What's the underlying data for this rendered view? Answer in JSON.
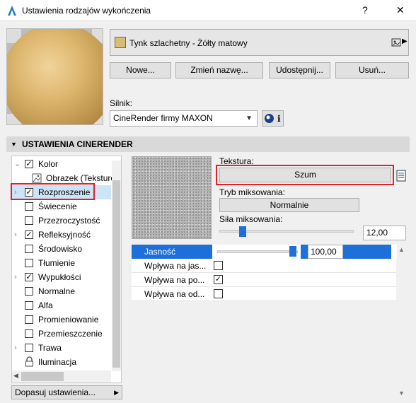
{
  "window": {
    "title": "Ustawienia rodzajów wykończenia",
    "help": "?",
    "close": "✕"
  },
  "material": {
    "name": "Tynk szlachetny - Żółty matowy",
    "swatch_color": "#d8bd72"
  },
  "buttons": {
    "new": "Nowe...",
    "rename": "Zmień nazwę...",
    "share": "Udostępnij...",
    "delete": "Usuń..."
  },
  "engine": {
    "label": "Silnik:",
    "value": "CineRender firmy MAXON",
    "info": "i"
  },
  "section": {
    "title": "USTAWIENIA CINERENDER"
  },
  "channels": [
    {
      "label": "Kolor",
      "checked": "✓",
      "chevron": "⌄"
    },
    {
      "label": "Obrazek (Teksturo",
      "checked": "",
      "chevron": ""
    },
    {
      "label": "Rozproszenie",
      "checked": "✓",
      "chevron": "›"
    },
    {
      "label": "Świecenie",
      "checked": "",
      "chevron": ""
    },
    {
      "label": "Przezroczystość",
      "checked": "",
      "chevron": ""
    },
    {
      "label": "Refleksyjność",
      "checked": "✓",
      "chevron": "›"
    },
    {
      "label": "Środowisko",
      "checked": "",
      "chevron": ""
    },
    {
      "label": "Tłumienie",
      "checked": "",
      "chevron": ""
    },
    {
      "label": "Wypukłości",
      "checked": "✓",
      "chevron": "›"
    },
    {
      "label": "Normalne",
      "checked": "",
      "chevron": ""
    },
    {
      "label": "Alfa",
      "checked": "",
      "chevron": ""
    },
    {
      "label": "Promieniowanie",
      "checked": "",
      "chevron": ""
    },
    {
      "label": "Przemieszczenie",
      "checked": "",
      "chevron": ""
    },
    {
      "label": "Trawa",
      "checked": "",
      "chevron": "›"
    },
    {
      "label": "Iluminacja",
      "checked": "",
      "chevron": ""
    }
  ],
  "fit_settings": "Dopasuj ustawienia...",
  "texture": {
    "label": "Tekstura:",
    "value": "Szum",
    "mix_mode_label": "Tryb miksowania:",
    "mix_mode": "Normalnie",
    "mix_strength_label": "Siła miksowania:",
    "mix_strength": "12,00"
  },
  "brightness": {
    "label": "Jasność",
    "value": "100,00"
  },
  "affects": [
    {
      "label": "Wpływa na jas...",
      "checked": ""
    },
    {
      "label": "Wpływa na po...",
      "checked": "✓"
    },
    {
      "label": "Wpływa na od...",
      "checked": ""
    }
  ],
  "colors": {
    "accent": "#1e6fd9",
    "highlight": "#e0202a",
    "selection": "#cce4f7"
  }
}
